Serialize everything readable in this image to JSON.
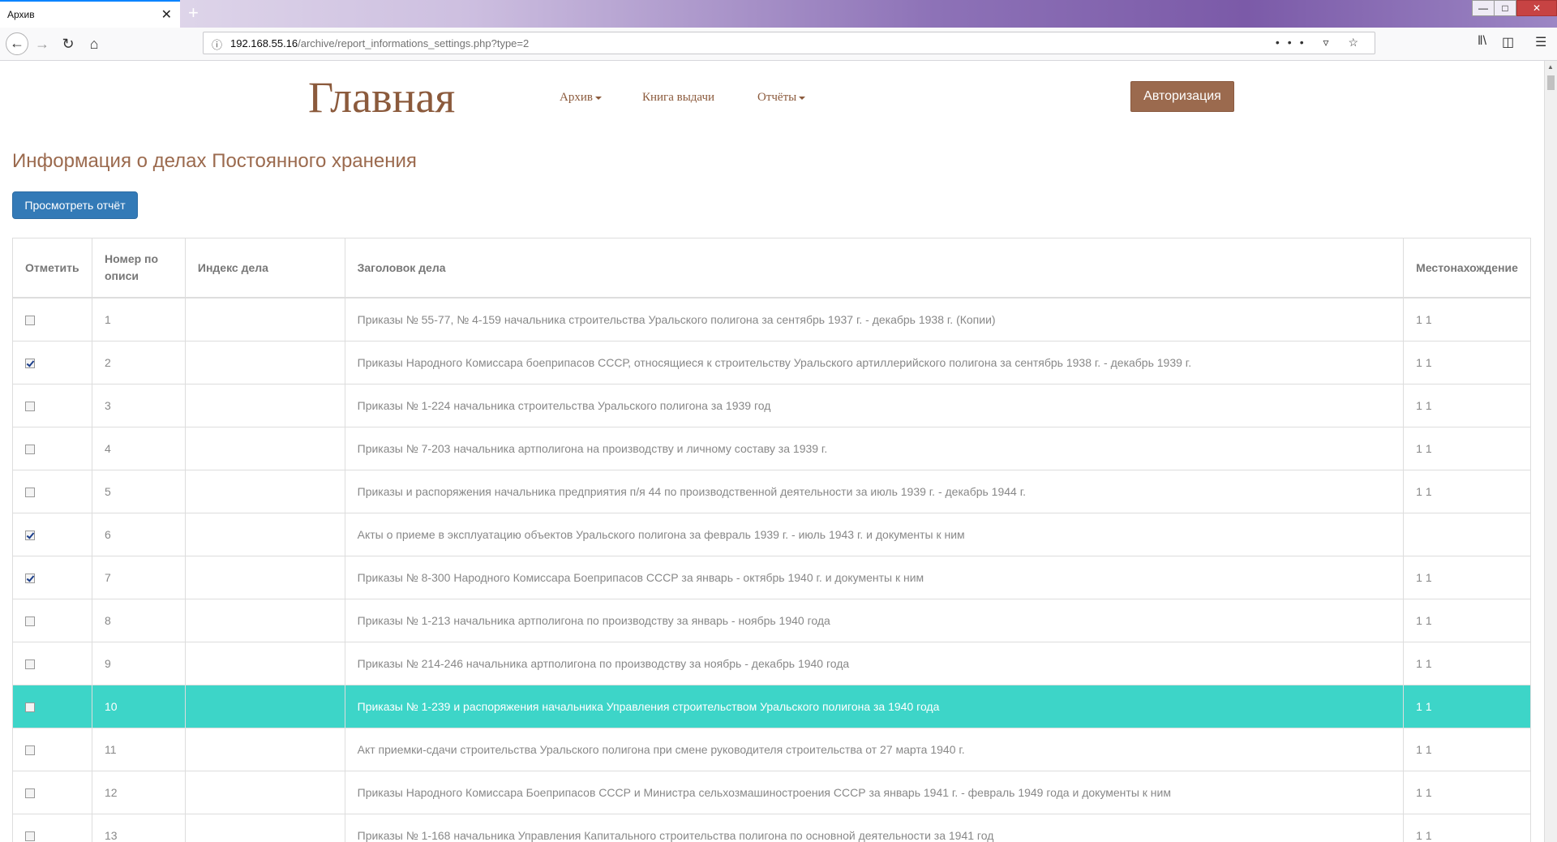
{
  "browser": {
    "tab_title": "Архив",
    "tab_close": "✕",
    "new_tab": "+",
    "url_host": "192.168.55.16",
    "url_path": "/archive/report_informations_settings.php?type=2"
  },
  "header": {
    "brand": "Главная",
    "menu": {
      "archive": "Архив",
      "issue_book": "Книга выдачи",
      "reports": "Отчёты"
    },
    "auth_button": "Авторизация"
  },
  "main": {
    "title": "Информация о делах Постоянного хранения",
    "view_report_button": "Просмотреть отчёт",
    "columns": {
      "mark": "Отметить",
      "inventory_number": "Номер по описи",
      "case_index": "Индекс дела",
      "case_title": "Заголовок дела",
      "location": "Местонахождение"
    },
    "rows": [
      {
        "checked": false,
        "num": "1",
        "index": "",
        "title": "Приказы № 55-77, № 4-159 начальника строительства Уральского полигона за сентябрь 1937 г. - декабрь 1938 г. (Копии)",
        "location": "1 1",
        "selected": false
      },
      {
        "checked": true,
        "num": "2",
        "index": "",
        "title": "Приказы Народного Комиссара боеприпасов СССР, относящиеся к строительству Уральского артиллерийского полигона за сентябрь 1938 г. - декабрь 1939 г.",
        "location": "1 1",
        "selected": false
      },
      {
        "checked": false,
        "num": "3",
        "index": "",
        "title": "Приказы № 1-224 начальника строительства Уральского полигона за 1939 год",
        "location": "1 1",
        "selected": false
      },
      {
        "checked": false,
        "num": "4",
        "index": "",
        "title": "Приказы № 7-203 начальника артполигона на производству и личному составу за 1939 г.",
        "location": "1 1",
        "selected": false
      },
      {
        "checked": false,
        "num": "5",
        "index": "",
        "title": "Приказы и распоряжения начальника предприятия п/я 44 по производственной деятельности за июль 1939 г. - декабрь 1944 г.",
        "location": "1 1",
        "selected": false
      },
      {
        "checked": true,
        "num": "6",
        "index": "",
        "title": "Акты о приеме в эксплуатацию объектов Уральского полигона за февраль 1939 г. - июль 1943 г. и документы к ним",
        "location": "",
        "selected": false
      },
      {
        "checked": true,
        "num": "7",
        "index": "",
        "title": "Приказы № 8-300 Народного Комиссара Боеприпасов СССР за январь - октябрь 1940 г. и документы к ним",
        "location": "1 1",
        "selected": false
      },
      {
        "checked": false,
        "num": "8",
        "index": "",
        "title": "Приказы № 1-213 начальника артполигона по производству за январь - ноябрь 1940 года",
        "location": "1 1",
        "selected": false
      },
      {
        "checked": false,
        "num": "9",
        "index": "",
        "title": "Приказы № 214-246 начальника артполигона по производству за ноябрь - декабрь 1940 года",
        "location": "1 1",
        "selected": false
      },
      {
        "checked": false,
        "num": "10",
        "index": "",
        "title": "Приказы № 1-239 и распоряжения начальника Управления строительством Уральского полигона за 1940 года",
        "location": "1 1",
        "selected": true
      },
      {
        "checked": false,
        "num": "11",
        "index": "",
        "title": "Акт приемки-сдачи строительства Уральского полигона при смене руководителя строительства от 27 марта 1940 г.",
        "location": "1 1",
        "selected": false
      },
      {
        "checked": false,
        "num": "12",
        "index": "",
        "title": "Приказы Народного Комиссара Боеприпасов СССР и Министра сельхозмашиностроения СССР за январь 1941 г. - февраль 1949 года и документы к ним",
        "location": "1 1",
        "selected": false
      },
      {
        "checked": false,
        "num": "13",
        "index": "",
        "title": "Приказы № 1-168 начальника Управления Капитального строительства полигона по основной деятельности за 1941 год",
        "location": "1 1",
        "selected": false
      }
    ]
  },
  "colors": {
    "brand": "#8b5a3c",
    "primary_button": "#337ab7",
    "selected_row": "#3dd5c8",
    "auth_button": "#9b6a4e"
  }
}
